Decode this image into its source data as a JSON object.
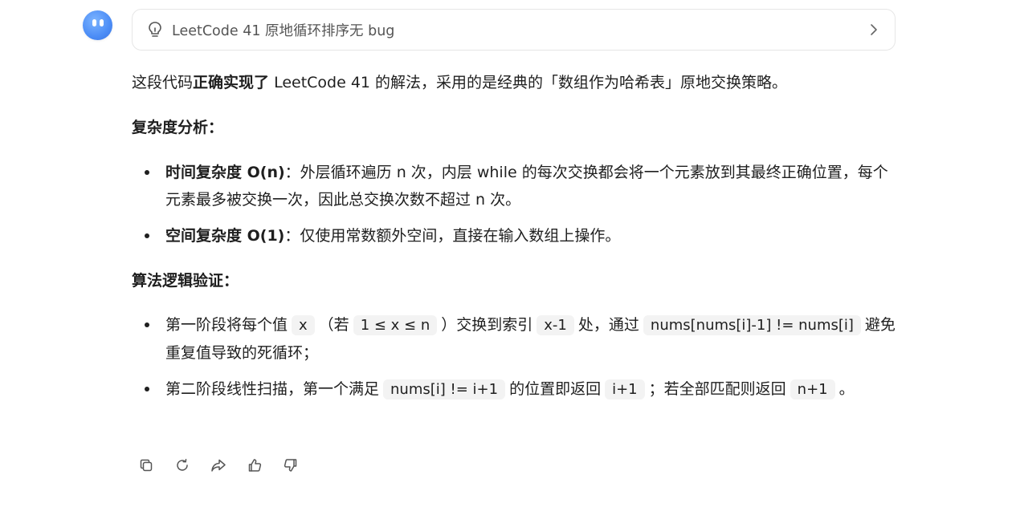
{
  "thought_panel": {
    "title": "LeetCode 41 原地循环排序无 bug"
  },
  "intro": {
    "part1": "这段代码",
    "bold": "正确实现了",
    "part2": " LeetCode 41 的解法，采用的是经典的「数组作为哈希表」原地交换策略。"
  },
  "complexity": {
    "heading": "复杂度分析：",
    "items": [
      {
        "label": "时间复杂度 O(n)",
        "text": "：外层循环遍历 n 次，内层 while 的每次交换都会将一个元素放到其最终正确位置，每个元素最多被交换一次，因此总交换次数不超过 n 次。"
      },
      {
        "label": "空间复杂度 O(1)",
        "text": "：仅使用常数额外空间，直接在输入数组上操作。"
      }
    ]
  },
  "logic": {
    "heading": "算法逻辑验证：",
    "item1": {
      "t1": "第一阶段将每个值",
      "c1": "x",
      "t2": "（若",
      "c2": "1 ≤ x ≤ n",
      "t3": "）交换到索引",
      "c3": "x-1",
      "t4": "处，通过",
      "c4": "nums[nums[i]-1] != nums[i]",
      "t5": "避免重复值导致的死循环；"
    },
    "item2": {
      "t1": "第二阶段线性扫描，第一个满足",
      "c1": "nums[i] != i+1",
      "t2": "的位置即返回",
      "c2": "i+1",
      "t3": "；若全部匹配则返回",
      "c3": "n+1",
      "t4": "。"
    }
  },
  "actions": [
    {
      "icon": "copy-icon"
    },
    {
      "icon": "regenerate-icon"
    },
    {
      "icon": "share-icon"
    },
    {
      "icon": "thumbs-up-icon"
    },
    {
      "icon": "thumbs-down-icon"
    }
  ],
  "colors": {
    "avatar": "#4c8df6",
    "text": "#1f1f1f",
    "code_bg": "#f3f3f3",
    "border": "#e6e6e6"
  }
}
